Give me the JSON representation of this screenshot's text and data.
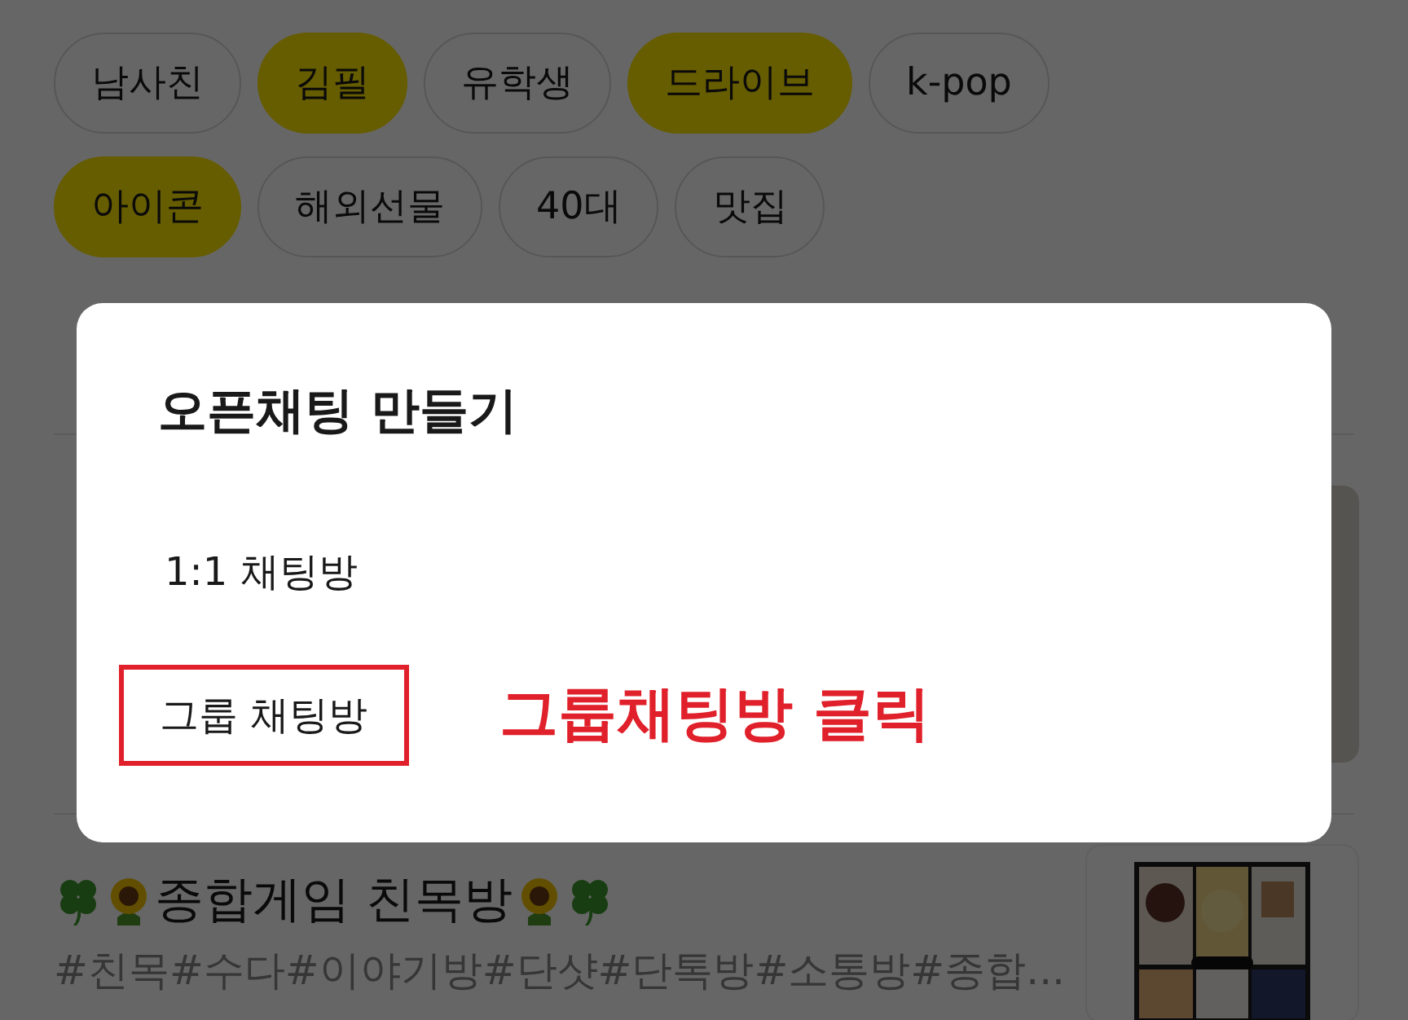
{
  "tags": [
    {
      "label": "남사친",
      "selected": false
    },
    {
      "label": "김필",
      "selected": true
    },
    {
      "label": "유학생",
      "selected": false
    },
    {
      "label": "드라이브",
      "selected": true
    },
    {
      "label": "k-pop",
      "selected": false
    },
    {
      "label": "아이콘",
      "selected": true
    },
    {
      "label": "해외선물",
      "selected": false
    },
    {
      "label": "40대",
      "selected": false
    },
    {
      "label": "맛집",
      "selected": false
    }
  ],
  "chat_list": [
    {
      "title": "종합게임 친목방",
      "hashtags": "#친목#수다#이야기방#단샷#단톡방#소통방#종합..."
    }
  ],
  "dialog": {
    "title": "오픈채팅 만들기",
    "options": [
      {
        "label": "1:1 채팅방",
        "highlighted": false
      },
      {
        "label": "그룹 채팅방",
        "highlighted": true
      }
    ],
    "annotation": "그룹채팅방 클릭"
  }
}
